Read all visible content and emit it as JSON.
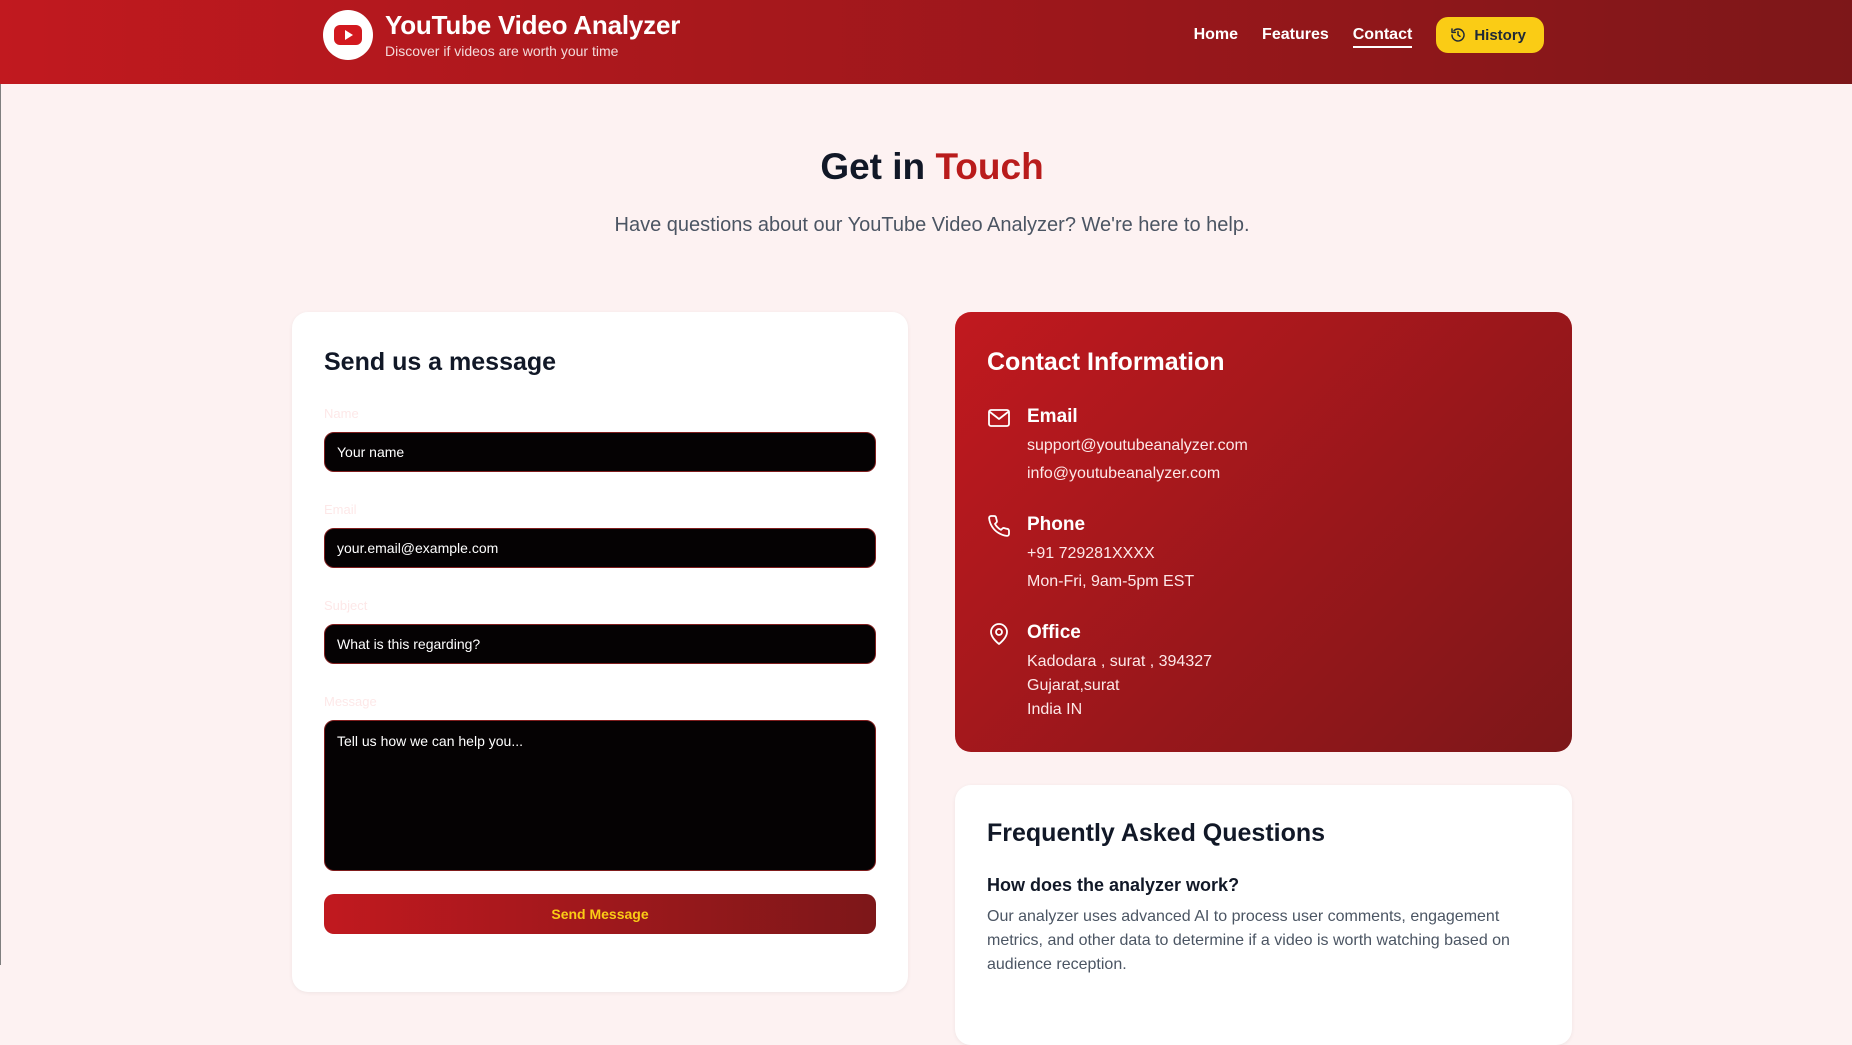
{
  "header": {
    "title": "YouTube Video Analyzer",
    "subtitle": "Discover if videos are worth your time",
    "nav": [
      "Home",
      "Features",
      "Contact"
    ],
    "active_nav": "Contact",
    "history_label": "History",
    "colors": {
      "brand": "#b91c1c",
      "accent": "#facc15"
    }
  },
  "hero": {
    "title_plain": "Get in",
    "title_accent": "Touch",
    "subtitle": "Have questions about our YouTube Video Analyzer? We're here to help."
  },
  "form": {
    "heading": "Send us a message",
    "name_label": "Name",
    "name_placeholder": "Your name",
    "email_label": "Email",
    "email_placeholder": "your.email@example.com",
    "subject_label": "Subject",
    "subject_placeholder": "What is this regarding?",
    "message_label": "Message",
    "message_placeholder": "Tell us how we can help you...",
    "submit_label": "Send Message"
  },
  "contact": {
    "heading": "Contact Information",
    "email": {
      "title": "Email",
      "lines": [
        "support@youtubeanalyzer.com",
        "info@youtubeanalyzer.com"
      ]
    },
    "phone": {
      "title": "Phone",
      "lines": [
        "+91 729281XXXX",
        "Mon-Fri, 9am-5pm EST"
      ]
    },
    "office": {
      "title": "Office",
      "lines": [
        "Kadodara , surat , 394327",
        "Gujarat,surat",
        "India IN"
      ]
    }
  },
  "faq": {
    "heading": "Frequently Asked Questions",
    "items": [
      {
        "question": "How does the analyzer work?",
        "answer": "Our analyzer uses advanced AI to process user comments, engagement metrics, and other data to determine if a video is worth watching based on audience reception."
      }
    ]
  }
}
